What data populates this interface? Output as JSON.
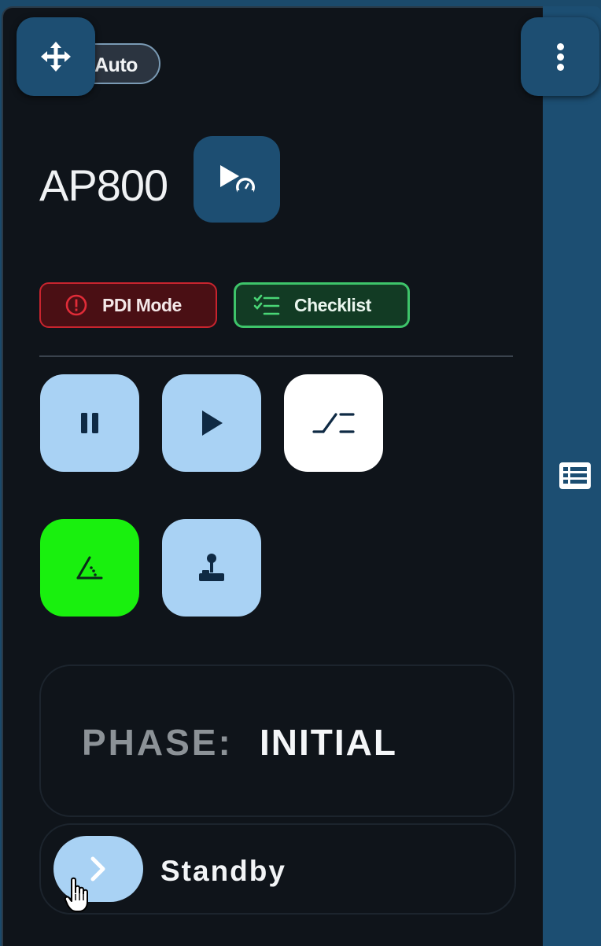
{
  "header": {
    "mode_pill": "Auto",
    "move_icon": "move-arrows-icon",
    "menu_icon": "more-vertical-icon"
  },
  "device": {
    "title": "AP800",
    "autopilot_icon": "play-speedometer-icon"
  },
  "chips": {
    "pdi_label": "PDI Mode",
    "pdi_icon": "alert-circle-icon",
    "checklist_label": "Checklist",
    "checklist_icon": "checklist-icon"
  },
  "controls": [
    {
      "name": "pause",
      "icon": "pause-icon",
      "style": "light"
    },
    {
      "name": "play",
      "icon": "play-icon",
      "style": "light"
    },
    {
      "name": "ramp",
      "icon": "ramp-icon",
      "style": "white"
    },
    {
      "name": "angle",
      "icon": "angle-icon",
      "style": "green"
    },
    {
      "name": "joystick",
      "icon": "joystick-icon",
      "style": "light"
    }
  ],
  "phase": {
    "label": "PHASE:",
    "value": "INITIAL"
  },
  "standby": {
    "label": "Standby",
    "icon": "chevron-right-icon"
  },
  "sidebar": {
    "icon": "list-table-icon"
  },
  "colors": {
    "panel_bg": "#0f141a",
    "rail_bg": "#1c4e72",
    "button_light": "#a9d2f4",
    "active_green": "#19f00e",
    "pdi_red": "#c8242e",
    "checklist_green": "#3ec46a"
  }
}
